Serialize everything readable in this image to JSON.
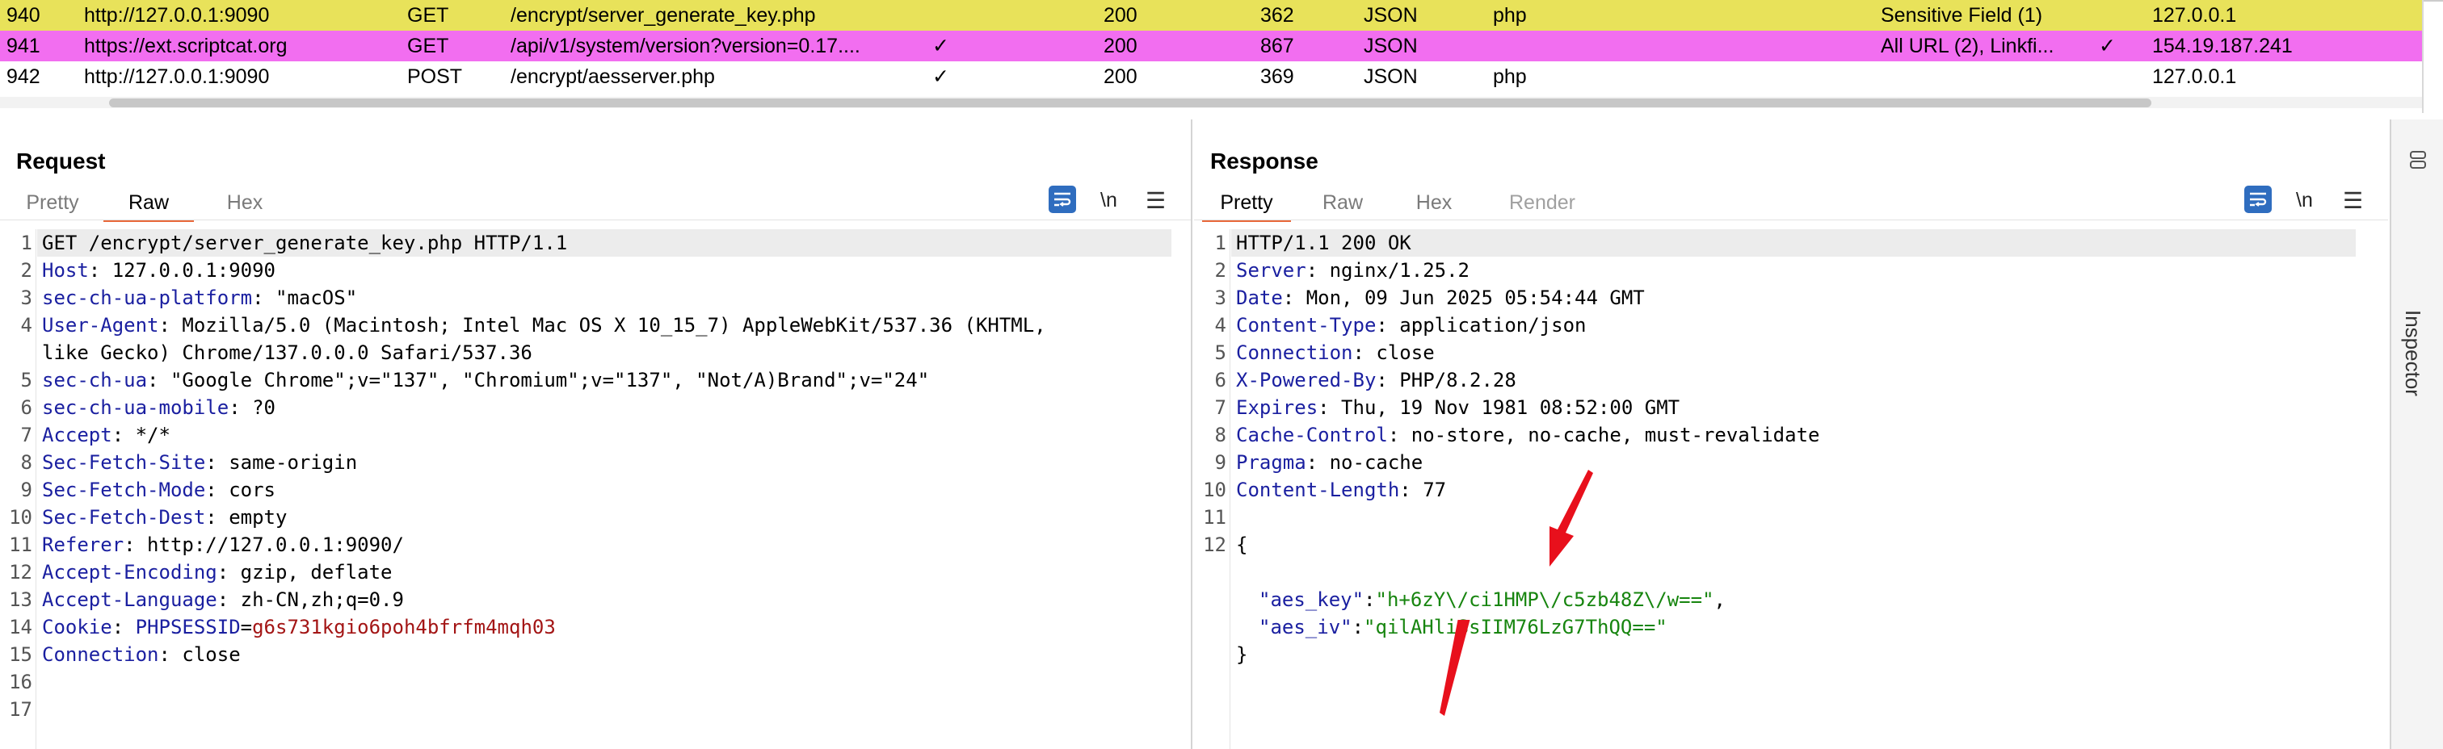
{
  "history": {
    "rows": [
      {
        "num": "940",
        "host": "http://127.0.0.1:9090",
        "method": "GET",
        "url": "/encrypt/server_generate_key.php",
        "params": "",
        "status": "200",
        "length": "362",
        "mime": "JSON",
        "ext": "php",
        "notes": "Sensitive Field (1)",
        "check2": "",
        "ip": "127.0.0.1",
        "color": "#e8e25a"
      },
      {
        "num": "941",
        "host": "https://ext.scriptcat.org",
        "method": "GET",
        "url": "/api/v1/system/version?version=0.17....",
        "params": "✓",
        "status": "200",
        "length": "867",
        "mime": "JSON",
        "ext": "",
        "notes": "All URL (2), Linkfi...",
        "check2": "✓",
        "ip": "154.19.187.241",
        "color": "#f26ef0"
      },
      {
        "num": "942",
        "host": "http://127.0.0.1:9090",
        "method": "POST",
        "url": "/encrypt/aesserver.php",
        "params": "✓",
        "status": "200",
        "length": "369",
        "mime": "JSON",
        "ext": "php",
        "notes": "",
        "check2": "",
        "ip": "127.0.0.1",
        "color": "#ffffff"
      }
    ]
  },
  "request": {
    "title": "Request",
    "tabs": [
      "Pretty",
      "Raw",
      "Hex"
    ],
    "active_tab": "Raw",
    "newline_label": "\\n",
    "lines": [
      {
        "n": "1",
        "k": "GET /encrypt/server_generate_key.php HTTP/1.1",
        "v": ""
      },
      {
        "n": "2",
        "k": "Host",
        "v": " 127.0.0.1:9090"
      },
      {
        "n": "3",
        "k": "sec-ch-ua-platform",
        "v": " \"macOS\""
      },
      {
        "n": "4",
        "k": "User-Agent",
        "v": " Mozilla/5.0 (Macintosh; Intel Mac OS X 10_15_7) AppleWebKit/537.36 (KHTML,"
      },
      {
        "n": "",
        "k": "",
        "v": "like Gecko) Chrome/137.0.0.0 Safari/537.36"
      },
      {
        "n": "5",
        "k": "sec-ch-ua",
        "v": " \"Google Chrome\";v=\"137\", \"Chromium\";v=\"137\", \"Not/A)Brand\";v=\"24\""
      },
      {
        "n": "6",
        "k": "sec-ch-ua-mobile",
        "v": " ?0"
      },
      {
        "n": "7",
        "k": "Accept",
        "v": " */*"
      },
      {
        "n": "8",
        "k": "Sec-Fetch-Site",
        "v": " same-origin"
      },
      {
        "n": "9",
        "k": "Sec-Fetch-Mode",
        "v": " cors"
      },
      {
        "n": "10",
        "k": "Sec-Fetch-Dest",
        "v": " empty"
      },
      {
        "n": "11",
        "k": "Referer",
        "v": " http://127.0.0.1:9090/"
      },
      {
        "n": "12",
        "k": "Accept-Encoding",
        "v": " gzip, deflate"
      },
      {
        "n": "13",
        "k": "Accept-Language",
        "v": " zh-CN,zh;q=0.9"
      },
      {
        "n": "14",
        "k": "Cookie",
        "v": " ",
        "ck": "PHPSESSID",
        "eq": "=",
        "cv": "g6s731kgio6poh4bfrfm4mqh03"
      },
      {
        "n": "15",
        "k": "Connection",
        "v": " close"
      },
      {
        "n": "16",
        "k": "",
        "v": ""
      },
      {
        "n": "17",
        "k": "",
        "v": ""
      }
    ]
  },
  "response": {
    "title": "Response",
    "tabs": [
      "Pretty",
      "Raw",
      "Hex",
      "Render"
    ],
    "active_tab": "Pretty",
    "newline_label": "\\n",
    "lines": [
      {
        "n": "1",
        "k": "",
        "v": "HTTP/1.1 200 OK"
      },
      {
        "n": "2",
        "k": "Server",
        "v": " nginx/1.25.2"
      },
      {
        "n": "3",
        "k": "Date",
        "v": " Mon, 09 Jun 2025 05:54:44 GMT"
      },
      {
        "n": "4",
        "k": "Content-Type",
        "v": " application/json"
      },
      {
        "n": "5",
        "k": "Connection",
        "v": " close"
      },
      {
        "n": "6",
        "k": "X-Powered-By",
        "v": " PHP/8.2.28"
      },
      {
        "n": "7",
        "k": "Expires",
        "v": " Thu, 19 Nov 1981 08:52:00 GMT"
      },
      {
        "n": "8",
        "k": "Cache-Control",
        "v": " no-store, no-cache, must-revalidate"
      },
      {
        "n": "9",
        "k": "Pragma",
        "v": " no-cache"
      },
      {
        "n": "10",
        "k": "Content-Length",
        "v": " 77"
      },
      {
        "n": "11",
        "k": "",
        "v": ""
      },
      {
        "n": "12",
        "k": "",
        "v": "{"
      }
    ],
    "json": {
      "aes_key_name": "\"aes_key\"",
      "aes_key_value": "\"h+6zY\\/ci1HMP\\/c5zb48Z\\/w==\"",
      "aes_iv_name": "\"aes_iv\"",
      "aes_iv_value": "\"qilAHliSsIIM76LzG7ThQQ==\"",
      "close": "}"
    }
  },
  "inspector": {
    "label": "Inspector"
  },
  "colors": {
    "accent": "#2f6dbf",
    "tab_underline": "#e8683a",
    "annotation_arrow": "#e8101c"
  }
}
